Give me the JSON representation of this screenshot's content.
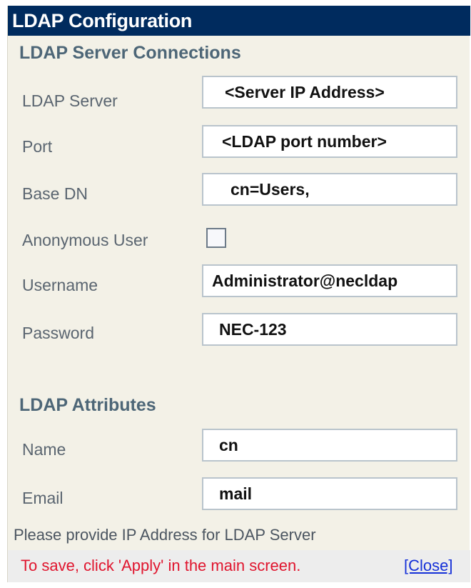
{
  "window": {
    "title": "LDAP Configuration"
  },
  "server_connections": {
    "heading": "LDAP Server Connections",
    "fields": [
      {
        "label": "LDAP Server",
        "value": "<Server IP Address>"
      },
      {
        "label": "Port",
        "value": "<LDAP port number>"
      },
      {
        "label": "Base DN",
        "value": "cn=Users,"
      },
      {
        "label": "Anonymous User",
        "checked": false
      },
      {
        "label": "Username",
        "value": "Administrator@necldap"
      },
      {
        "label": "Password",
        "value": "NEC-123"
      }
    ]
  },
  "attributes": {
    "heading": "LDAP Attributes",
    "fields": [
      {
        "label": "Name",
        "value": "cn"
      },
      {
        "label": "Email",
        "value": "mail"
      }
    ]
  },
  "hint": "Please provide IP Address for LDAP Server",
  "footer": {
    "save_note": "To save, click 'Apply' in the main screen.",
    "close_label": "[Close]"
  },
  "colors": {
    "title_bg": "#002b5e",
    "panel_bg": "#f3f1e7",
    "note_red": "#e0152e",
    "link_blue": "#1530d8"
  }
}
